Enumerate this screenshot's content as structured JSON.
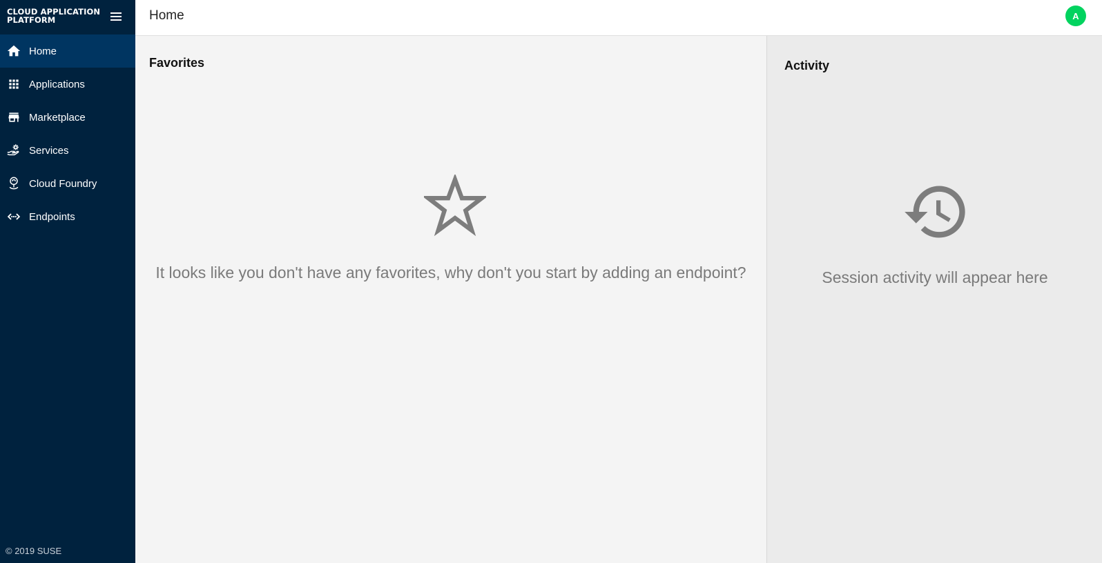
{
  "app": {
    "brand": "CLOUD APPLICATION PLATFORM",
    "copyright": "© 2019 SUSE"
  },
  "sidebar": {
    "items": [
      {
        "label": "Home",
        "icon": "home-icon",
        "active": true
      },
      {
        "label": "Applications",
        "icon": "apps-grid-icon",
        "active": false
      },
      {
        "label": "Marketplace",
        "icon": "store-icon",
        "active": false
      },
      {
        "label": "Services",
        "icon": "service-hand-gear-icon",
        "active": false
      },
      {
        "label": "Cloud Foundry",
        "icon": "cloud-foundry-icon",
        "active": false
      },
      {
        "label": "Endpoints",
        "icon": "endpoints-icon",
        "active": false
      }
    ]
  },
  "header": {
    "title": "Home",
    "avatar_initial": "A"
  },
  "favorites": {
    "title": "Favorites",
    "icon": "star-outline-icon",
    "empty_message": "It looks like you don't have any favorites, why don't you start by adding an endpoint?"
  },
  "activity": {
    "title": "Activity",
    "icon": "history-icon",
    "empty_message": "Session activity will appear here"
  },
  "colors": {
    "sidebar_bg": "#00223e",
    "sidebar_active": "#003561",
    "avatar": "#02d35f",
    "muted_text": "#7a7a7a"
  }
}
